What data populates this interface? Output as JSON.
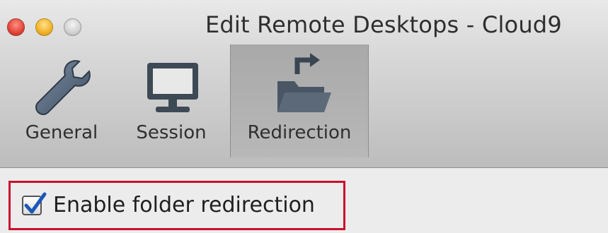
{
  "window": {
    "title": "Edit Remote Desktops - Cloud9"
  },
  "toolbar": {
    "tabs": [
      {
        "label": "General",
        "icon": "wrench-icon",
        "selected": false
      },
      {
        "label": "Session",
        "icon": "monitor-icon",
        "selected": false
      },
      {
        "label": "Redirection",
        "icon": "folder-redirect-icon",
        "selected": true
      }
    ]
  },
  "redirection": {
    "enable_folder_redirection": {
      "label": "Enable folder redirection",
      "checked": true
    }
  },
  "colors": {
    "highlight_box": "#c8102e",
    "checkmark": "#1d57b8"
  }
}
